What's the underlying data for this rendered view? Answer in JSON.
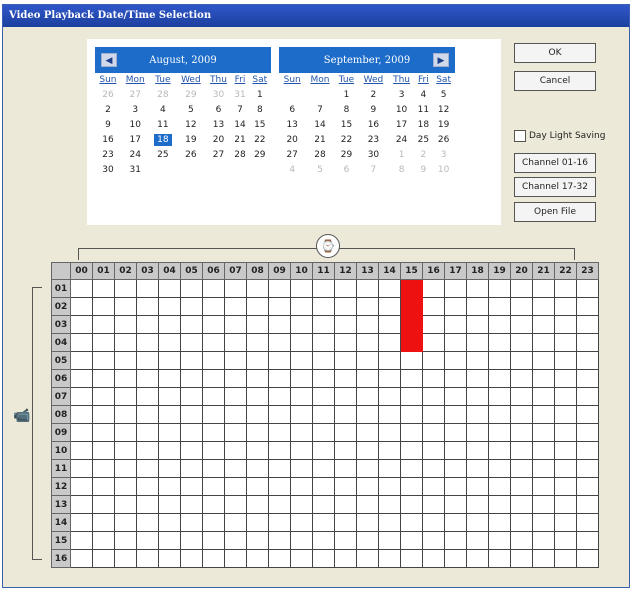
{
  "window": {
    "title": "Video Playback Date/Time Selection"
  },
  "calendar_left": {
    "title": "August, 2009",
    "prev_icon": "chevron-left-icon",
    "weekdays": [
      "Sun",
      "Mon",
      "Tue",
      "Wed",
      "Thu",
      "Fri",
      "Sat"
    ],
    "weeks": [
      [
        "26",
        "27",
        "28",
        "29",
        "30",
        "31",
        "1"
      ],
      [
        "2",
        "3",
        "4",
        "5",
        "6",
        "7",
        "8"
      ],
      [
        "9",
        "10",
        "11",
        "12",
        "13",
        "14",
        "15"
      ],
      [
        "16",
        "17",
        "18",
        "19",
        "20",
        "21",
        "22"
      ],
      [
        "23",
        "24",
        "25",
        "26",
        "27",
        "28",
        "29"
      ],
      [
        "30",
        "31",
        "",
        "",
        "",
        "",
        ""
      ]
    ],
    "selected": "18"
  },
  "calendar_right": {
    "title": "September, 2009",
    "next_icon": "chevron-right-icon",
    "weekdays": [
      "Sun",
      "Mon",
      "Tue",
      "Wed",
      "Thu",
      "Fri",
      "Sat"
    ],
    "weeks": [
      [
        "",
        "",
        "1",
        "2",
        "3",
        "4",
        "5"
      ],
      [
        "6",
        "7",
        "8",
        "9",
        "10",
        "11",
        "12"
      ],
      [
        "13",
        "14",
        "15",
        "16",
        "17",
        "18",
        "19"
      ],
      [
        "20",
        "21",
        "22",
        "23",
        "24",
        "25",
        "26"
      ],
      [
        "27",
        "28",
        "29",
        "30",
        "1",
        "2",
        "3"
      ],
      [
        "4",
        "5",
        "6",
        "7",
        "8",
        "9",
        "10"
      ]
    ]
  },
  "buttons": {
    "ok": "OK",
    "cancel": "Cancel",
    "channel_1": "Channel 01-16",
    "channel_2": "Channel 17-32",
    "open_file": "Open File"
  },
  "daylight": {
    "label": "Day Light Saving",
    "checked": false
  },
  "grid": {
    "hours": [
      "00",
      "01",
      "02",
      "03",
      "04",
      "05",
      "06",
      "07",
      "08",
      "09",
      "10",
      "11",
      "12",
      "13",
      "14",
      "15",
      "16",
      "17",
      "18",
      "19",
      "20",
      "21",
      "22",
      "23"
    ],
    "channels": [
      "01",
      "02",
      "03",
      "04",
      "05",
      "06",
      "07",
      "08",
      "09",
      "10",
      "11",
      "12",
      "13",
      "14",
      "15",
      "16"
    ],
    "recorded": [
      {
        "channel": "01",
        "hour": "15"
      },
      {
        "channel": "02",
        "hour": "15"
      },
      {
        "channel": "03",
        "hour": "15"
      },
      {
        "channel": "04",
        "hour": "15"
      }
    ],
    "record_color": "#ee1111"
  },
  "icons": {
    "clock": "clock-icon",
    "camera": "camera-icon"
  }
}
